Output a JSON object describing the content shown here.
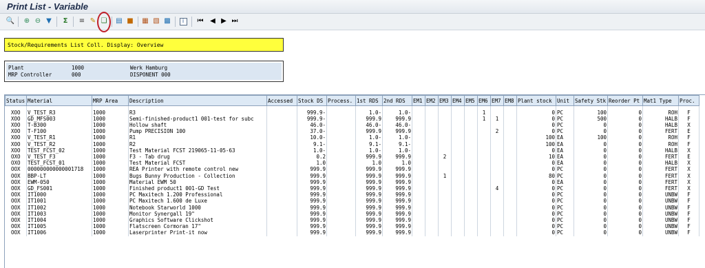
{
  "title": "Print List - Variable",
  "toolbar_icons": [
    "check-icon",
    "sort-asc-icon",
    "sort-desc-icon",
    "filter-icon",
    "sum-icon",
    "subtotal-icon",
    "print-preview-icon",
    "export-icon",
    "change-layout-icon",
    "save-layout-icon",
    "choose-layout-icon",
    "send-icon",
    "spreadsheet-icon",
    "word-processing-icon",
    "info-icon",
    "first-page-icon",
    "previous-page-icon",
    "next-page-icon",
    "last-page-icon"
  ],
  "header_text": "Stock/Requirements List Coll. Display: Overview",
  "info": {
    "plant_label": "Plant",
    "plant_value": "1000",
    "plant_name": "Werk Hamburg",
    "mrp_label": "MRP Controller",
    "mrp_value": "000",
    "mrp_name": "DISPONENT 000"
  },
  "table": {
    "columns": [
      "Status",
      "Material",
      "MRP Area",
      "Description",
      "Accessed",
      "Stock DS",
      "Process.",
      "1st RDS",
      "2nd RDS",
      "EM1",
      "EM2",
      "EM3",
      "EM4",
      "EM5",
      "EM6",
      "EM7",
      "EM8",
      "Plant stock",
      "Unit",
      "Safety Stk",
      "Reorder Pt",
      "Mat1 Type",
      "Proc."
    ],
    "rows": [
      [
        "XOO",
        "V_TEST_R3",
        "1000",
        "R3",
        "",
        "999.9-",
        "",
        "1.0-",
        "1.0-",
        "",
        "",
        "",
        "",
        "",
        "1",
        "",
        "",
        "0",
        "PC",
        "100",
        "0",
        "ROH",
        "F"
      ],
      [
        "XOO",
        "GD_MFS003",
        "1000",
        "Semi-finished-product1 001-test for subc",
        "",
        "999.9-",
        "",
        "999.9",
        "999.9",
        "",
        "",
        "",
        "",
        "",
        "1",
        "1",
        "",
        "0",
        "PC",
        "500",
        "0",
        "HALB",
        "F"
      ],
      [
        "XOO",
        "T-B300",
        "1000",
        "Hollow shaft",
        "",
        "46.0-",
        "",
        "46.0-",
        "46.0-",
        "",
        "",
        "",
        "",
        "",
        "",
        "",
        "",
        "0",
        "PC",
        "0",
        "0",
        "HALB",
        "X"
      ],
      [
        "XOO",
        "T-F100",
        "1000",
        "Pump PRECISION 100",
        "",
        "37.0-",
        "",
        "999.9",
        "999.9",
        "",
        "",
        "",
        "",
        "",
        "",
        "2",
        "",
        "0",
        "PC",
        "0",
        "0",
        "FERT",
        "E"
      ],
      [
        "XOO",
        "V_TEST_R1",
        "1000",
        "R1",
        "",
        "10.0-",
        "",
        "1.0-",
        "1.0-",
        "",
        "",
        "",
        "",
        "",
        "",
        "",
        "",
        "100",
        "EA",
        "100",
        "0",
        "ROH",
        "F"
      ],
      [
        "XOO",
        "V_TEST_R2",
        "1000",
        "R2",
        "",
        "9.1-",
        "",
        "9.1-",
        "9.1-",
        "",
        "",
        "",
        "",
        "",
        "",
        "",
        "",
        "100",
        "EA",
        "0",
        "0",
        "ROH",
        "F"
      ],
      [
        "XOO",
        "TEST_FCST_02",
        "1000",
        "Test Material FCST 219065-11-05-63",
        "",
        "1.0-",
        "",
        "1.0-",
        "1.0-",
        "",
        "",
        "",
        "",
        "",
        "",
        "",
        "",
        "0",
        "EA",
        "0",
        "0",
        "HALB",
        "X"
      ],
      [
        "OXO",
        "V_TEST_F3",
        "1000",
        "F3 - Tab drug",
        "",
        "0.2",
        "",
        "999.9",
        "999.9",
        "",
        "",
        "2",
        "",
        "",
        "",
        "",
        "",
        "10",
        "EA",
        "0",
        "0",
        "FERT",
        "E"
      ],
      [
        "OXO",
        "TEST_FCST_01",
        "1000",
        "Test Material FCST",
        "",
        "1.0",
        "",
        "1.0",
        "1.0",
        "",
        "",
        "",
        "",
        "",
        "",
        "",
        "",
        "0",
        "EA",
        "0",
        "0",
        "HALB",
        "X"
      ],
      [
        "OOX",
        "000000000000001718",
        "1000",
        "REA Printer with remote control new",
        "",
        "999.9",
        "",
        "999.9",
        "999.9",
        "",
        "",
        "",
        "",
        "",
        "",
        "",
        "",
        "0",
        "PC",
        "0",
        "0",
        "FERT",
        "X"
      ],
      [
        "OOX",
        "BBP-LT",
        "1000",
        "Bugs Bunny Production - Collection",
        "",
        "999.9",
        "",
        "999.9",
        "999.9",
        "",
        "",
        "1",
        "",
        "",
        "",
        "",
        "",
        "80",
        "PC",
        "0",
        "0",
        "FERT",
        "X"
      ],
      [
        "OOX",
        "EWM-050",
        "1000",
        "Material EWM 50",
        "",
        "999.9",
        "",
        "999.9",
        "999.9",
        "",
        "",
        "",
        "",
        "",
        "",
        "",
        "",
        "0",
        "EA",
        "0",
        "0",
        "FERT",
        "X"
      ],
      [
        "OOX",
        "GD_FS001",
        "1000",
        "Finished product1 001-GD Test",
        "",
        "999.9",
        "",
        "999.9",
        "999.9",
        "",
        "",
        "",
        "",
        "",
        "",
        "4",
        "",
        "0",
        "PC",
        "0",
        "0",
        "FERT",
        "X"
      ],
      [
        "OOX",
        "IT1000",
        "1000",
        "PC Maxitech 1.200 Professional",
        "",
        "999.9",
        "",
        "999.9",
        "999.9",
        "",
        "",
        "",
        "",
        "",
        "",
        "",
        "",
        "0",
        "PC",
        "0",
        "0",
        "UNBW",
        "F"
      ],
      [
        "OOX",
        "IT1001",
        "1000",
        "PC Maxitech 1.600 de Luxe",
        "",
        "999.9",
        "",
        "999.9",
        "999.9",
        "",
        "",
        "",
        "",
        "",
        "",
        "",
        "",
        "0",
        "PC",
        "0",
        "0",
        "UNBW",
        "F"
      ],
      [
        "OOX",
        "IT1002",
        "1000",
        "Notebook Starworld 1000",
        "",
        "999.9",
        "",
        "999.9",
        "999.9",
        "",
        "",
        "",
        "",
        "",
        "",
        "",
        "",
        "0",
        "PC",
        "0",
        "0",
        "UNBW",
        "F"
      ],
      [
        "OOX",
        "IT1003",
        "1000",
        "Monitor Synergall 19\"",
        "",
        "999.9",
        "",
        "999.9",
        "999.9",
        "",
        "",
        "",
        "",
        "",
        "",
        "",
        "",
        "0",
        "PC",
        "0",
        "0",
        "UNBW",
        "F"
      ],
      [
        "OOX",
        "IT1004",
        "1000",
        "Graphics Software Clickshot",
        "",
        "999.9",
        "",
        "999.9",
        "999.9",
        "",
        "",
        "",
        "",
        "",
        "",
        "",
        "",
        "0",
        "PC",
        "0",
        "0",
        "UNBW",
        "F"
      ],
      [
        "OOX",
        "IT1005",
        "1000",
        "Flatscreen Cormoran 17\"",
        "",
        "999.9",
        "",
        "999.9",
        "999.9",
        "",
        "",
        "",
        "",
        "",
        "",
        "",
        "",
        "0",
        "PC",
        "0",
        "0",
        "UNBW",
        "F"
      ],
      [
        "OOX",
        "IT1006",
        "1000",
        "Laserprinter Print-it now",
        "",
        "999.9",
        "",
        "999.9",
        "999.9",
        "",
        "",
        "",
        "",
        "",
        "",
        "",
        "",
        "0",
        "PC",
        "0",
        "0",
        "UNBW",
        "F"
      ]
    ]
  },
  "colors": {
    "header_yellow": "#ffff3c",
    "grid_header": "#dde9f5",
    "info_fill": "#dbe6f2",
    "highlight": "#c0202a"
  }
}
